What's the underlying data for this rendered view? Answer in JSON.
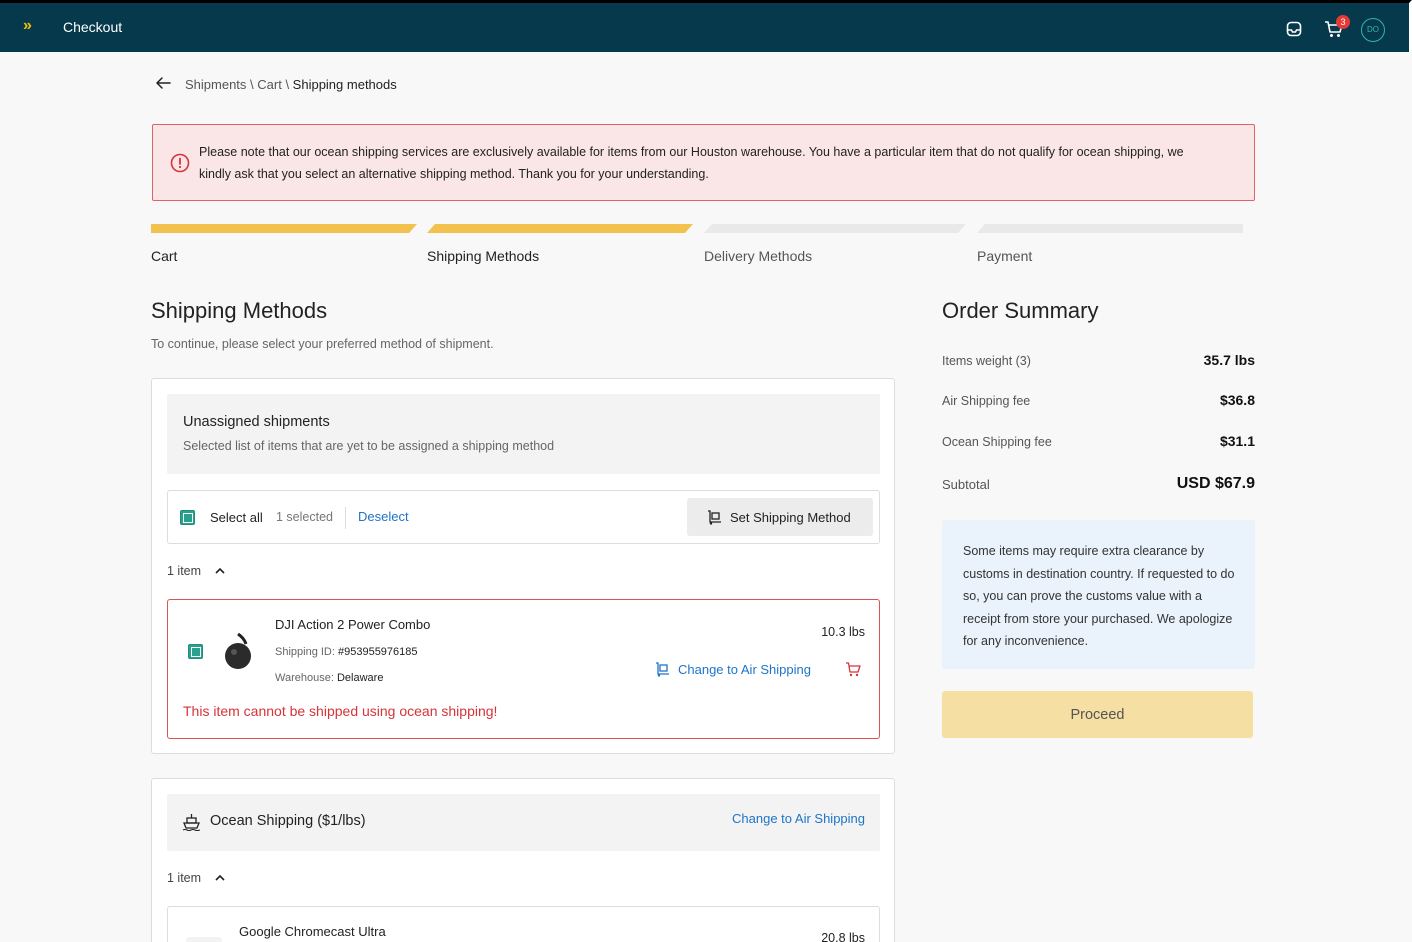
{
  "header": {
    "logo": "»",
    "title": "Checkout",
    "cart_count": "3",
    "avatar_initials": "DO"
  },
  "breadcrumb": {
    "parts": [
      "Shipments",
      "Cart"
    ],
    "separator": " \\ ",
    "current": "Shipping methods"
  },
  "alert": {
    "text": "Please note that our ocean shipping services are exclusively available for items from our Houston warehouse. You have a particular item that do not qualify for ocean shipping, we kindly ask that you select an alternative shipping method. Thank you for your understanding."
  },
  "steps": [
    {
      "label": "Cart",
      "done": true
    },
    {
      "label": "Shipping Methods",
      "done": true
    },
    {
      "label": "Delivery Methods",
      "done": false
    },
    {
      "label": "Payment",
      "done": false
    }
  ],
  "main": {
    "title": "Shipping Methods",
    "subtitle": "To continue, please select your preferred method of shipment."
  },
  "unassigned": {
    "title": "Unassigned shipments",
    "subtitle": "Selected list of items that are yet to be assigned a shipping method",
    "select_all_label": "Select all",
    "selected_count": "1 selected",
    "deselect_label": "Deselect",
    "set_method_label": "Set Shipping Method",
    "items_toggle": "1 item",
    "item": {
      "name": "DJI Action 2 Power Combo",
      "shipping_id_label": "Shipping ID: ",
      "shipping_id": "#953955976185",
      "warehouse_label": "Warehouse: ",
      "warehouse": "Delaware",
      "weight": "10.3 lbs",
      "change_label": "Change to Air Shipping",
      "error": "This item cannot be shipped using  ocean shipping!"
    }
  },
  "ocean": {
    "title": "Ocean Shipping ($1/lbs)",
    "change_label": "Change to Air Shipping",
    "items_toggle": "1 item",
    "item": {
      "name": "Google Chromecast Ultra",
      "weight": "20.8 lbs"
    }
  },
  "order_summary": {
    "title": "Order Summary",
    "rows": [
      {
        "label": "Items weight (3)",
        "value": "35.7 lbs"
      },
      {
        "label": "Air Shipping fee",
        "value": "$36.8"
      },
      {
        "label": "Ocean Shipping fee",
        "value": "$31.1"
      }
    ],
    "subtotal_label": "Subtotal",
    "subtotal_value": "USD $67.9",
    "note": "Some items may require extra clearance by customs in destination country. If requested to do so, you can prove the customs value with a receipt from store your purchased. We apologize for any inconvenience.",
    "proceed_label": "Proceed"
  },
  "colors": {
    "topbar": "#07394c",
    "accent_yellow": "#f2c14e",
    "error_red": "#d6333a",
    "link_blue": "#1f74c9",
    "checkbox_teal": "#2aa18f"
  }
}
